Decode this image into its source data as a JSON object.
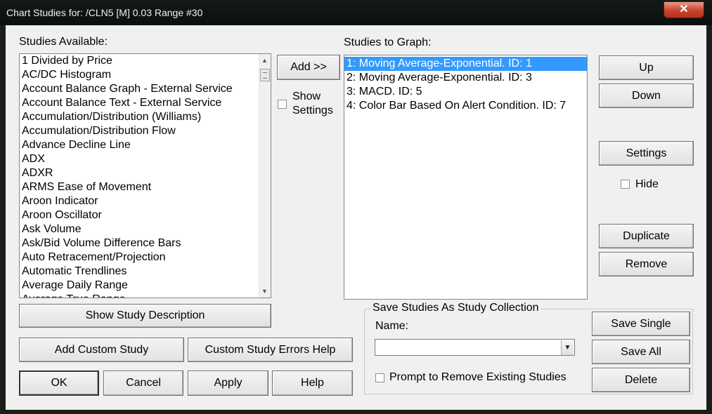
{
  "window": {
    "title": "Chart Studies for: /CLN5 [M]  0.03 Range  #30",
    "close_glyph": "✕"
  },
  "studies_available": {
    "label": "Studies Available:",
    "items": [
      "1 Divided by Price",
      "AC/DC Histogram",
      "Account Balance Graph - External Service",
      "Account Balance Text - External Service",
      "Accumulation/Distribution (Williams)",
      "Accumulation/Distribution Flow",
      "Advance Decline Line",
      "ADX",
      "ADXR",
      "ARMS Ease of Movement",
      "Aroon Indicator",
      "Aroon Oscillator",
      "Ask Volume",
      "Ask/Bid Volume Difference Bars",
      "Auto Retracement/Projection",
      "Automatic Trendlines",
      "Average Daily Range",
      "Average True Range"
    ]
  },
  "studies_to_graph": {
    "label": "Studies to Graph:",
    "items": [
      "1: Moving Average-Exponential. ID: 1",
      "2: Moving Average-Exponential. ID: 3",
      "3: MACD. ID: 5",
      "4: Color Bar Based On Alert Condition. ID: 7"
    ],
    "selected_index": 0
  },
  "buttons": {
    "add": "Add >>",
    "show_settings_line1": "Show",
    "show_settings_line2": "Settings",
    "up": "Up",
    "down": "Down",
    "settings": "Settings",
    "hide": "Hide",
    "duplicate": "Duplicate",
    "remove": "Remove",
    "show_study_description": "Show Study Description",
    "add_custom_study": "Add Custom Study",
    "custom_study_errors_help": "Custom Study Errors Help",
    "ok": "OK",
    "cancel": "Cancel",
    "apply": "Apply",
    "help": "Help"
  },
  "save_collection": {
    "group_title": "Save Studies As Study Collection",
    "name_label": "Name:",
    "name_value": "",
    "prompt_remove": "Prompt to Remove Existing Studies",
    "save_single": "Save Single",
    "save_all": "Save All",
    "delete": "Delete"
  },
  "colors": {
    "selection": "#3399ff",
    "dialog_bg": "#f0f0f0",
    "close_button": "#c8412b"
  }
}
